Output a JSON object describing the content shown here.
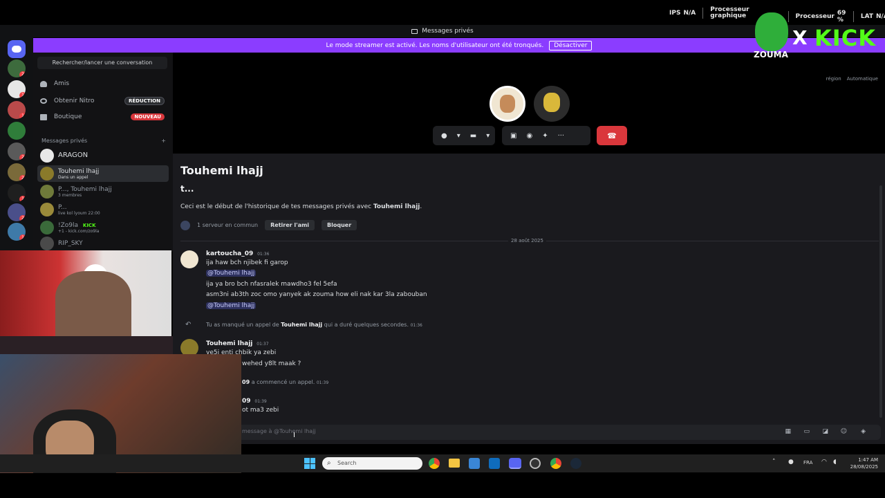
{
  "hud": {
    "ips_label": "IPS",
    "ips_value": "N/A",
    "gpu_label_line1": "Processeur",
    "gpu_label_line2": "graphique",
    "cpu_label": "Processeur",
    "cpu_value": "69 %",
    "lat_label": "LAT",
    "lat_value": "N/A"
  },
  "overlay": {
    "x": "X",
    "kick": "KICK",
    "streamer": "ZOUMA"
  },
  "titlebar": {
    "title": "Messages privés"
  },
  "banner": {
    "text": "Le mode streamer est activé. Les noms d'utilisateur ont été tronqués.",
    "button": "Désactiver"
  },
  "sidebar": {
    "search": "Rechercher/lancer une conversation",
    "nav": [
      {
        "label": "Amis"
      },
      {
        "label": "Obtenir Nitro",
        "pill": "RÉDUCTION"
      },
      {
        "label": "Boutique",
        "pill": "NOUVEAU"
      }
    ],
    "dm_header": "Messages privés",
    "dm_add": "+",
    "dms": [
      {
        "name": "ARAGON",
        "sub": ""
      },
      {
        "name": "Touhemi lhajj",
        "sub": "Dans un appel"
      },
      {
        "name": "P..., Touhemi lhajj",
        "sub": "3 membres"
      },
      {
        "name": "P...",
        "sub": "live kol lyoum 22:00"
      },
      {
        "name": "!Zo9la",
        "sub": "+1 - kick.com/zo9la",
        "tag": "KICK"
      },
      {
        "name": "RIP_SKY",
        "sub": ""
      }
    ]
  },
  "call": {
    "region_label": "région",
    "region_value": "Automatique"
  },
  "chat": {
    "title": "Touhemi lhajj",
    "subtitle": "t...",
    "intro_prefix": "Ceci est le début de l'historique de tes messages privés avec ",
    "intro_name": "Touhemi lhajj",
    "intro_suffix": ".",
    "mutual": "1 serveur en commun",
    "remove_friend": "Retirer l'ami",
    "block": "Bloquer",
    "date_divider": "28 août 2025",
    "messages": [
      {
        "author": "kartoucha_09",
        "time": "01:36"
      },
      {
        "text": "ija haw bch njibek fi garop"
      },
      {
        "mention": "@Touhemi lhajj"
      },
      {
        "text": "ija ya bro bch nfasralek mawdho3 fel 5efa"
      },
      {
        "text": "asm3ni ab3th zoc omo yanyek ak zouma how eli nak kar 3la zabouban"
      },
      {
        "mention": "@Touhemi lhajj"
      }
    ],
    "missed_call_prefix": "Tu as manqué un appel de ",
    "missed_call_name": "Touhemi lhajj",
    "missed_call_suffix": " qui a duré quelques secondes.",
    "missed_call_time": "01:36",
    "reply_author": "Touhemi lhajj",
    "reply_time": "01:37",
    "reply_line1": "ye5i enti chbik ya zebi",
    "reply_line2": "wehed y8lt maak ?",
    "call_start_name": "09",
    "call_start_text": "a commencé un appel.",
    "call_start_time": "01:39",
    "last_author": "09",
    "last_time": "01:39",
    "last_text": "ot ma3 zebi",
    "composer_placeholder": "message à @Touhemi lhajj"
  },
  "taskbar": {
    "search": "Search",
    "lang": "FRA",
    "time": "1:47 AM",
    "date": "28/08/2025"
  }
}
